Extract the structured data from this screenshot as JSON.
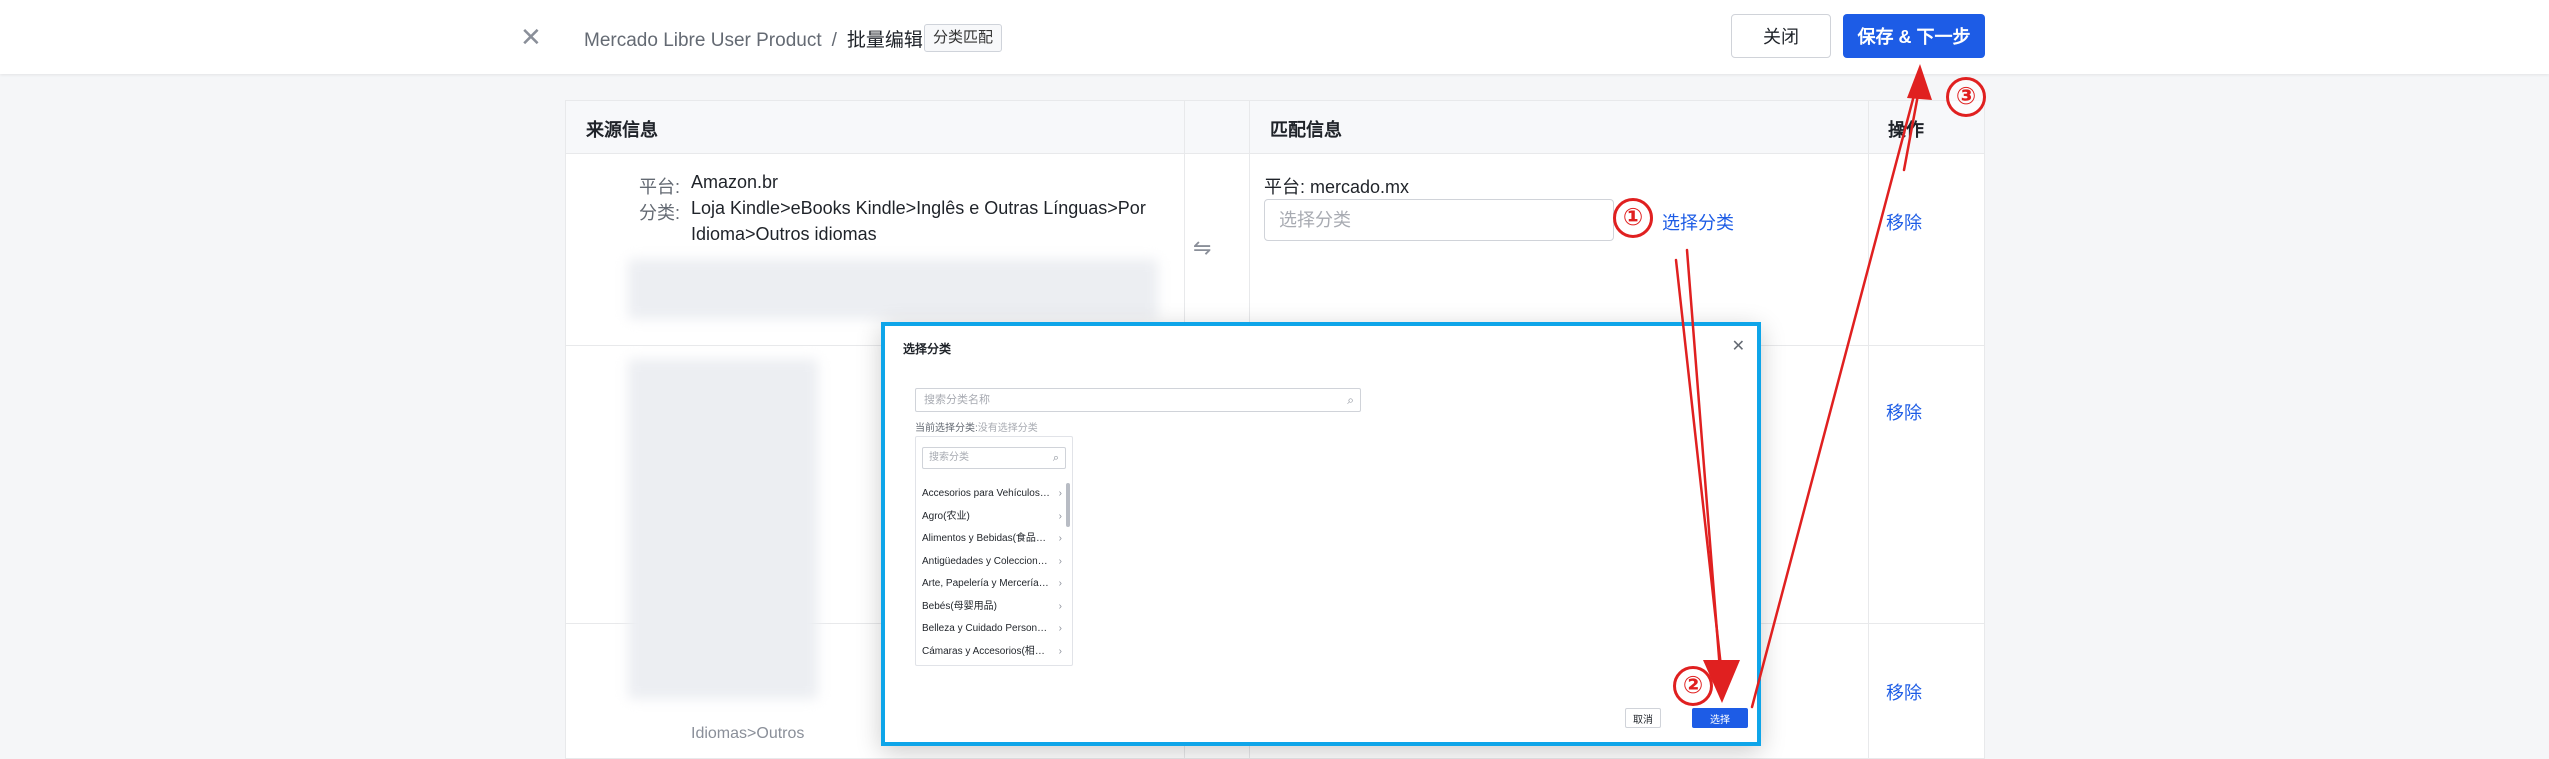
{
  "header": {
    "close_icon": "close-icon",
    "breadcrumb": {
      "app": "Mercado Libre User Product",
      "separator": "/",
      "page": "批量编辑"
    },
    "tag": "分类匹配",
    "close_button": "关闭",
    "save_button": "保存 & 下一步"
  },
  "table": {
    "columns": [
      "来源信息",
      "匹配信息",
      "操作"
    ],
    "rows": [
      {
        "source_platform_label": "平台:",
        "source_platform": "Amazon.br",
        "source_category_label": "分类:",
        "source_category_line1": "Loja Kindle>eBooks Kindle>Inglês e Outras Línguas>Por",
        "source_category_line2": "Idioma>Outros idiomas",
        "target_platform": "平台: mercado.mx",
        "target_placeholder": "选择分类",
        "select_link": "选择分类",
        "remove": "移除"
      },
      {
        "remove": "移除"
      },
      {
        "remove": "移除",
        "partial_text": "Idiomas>Outros"
      }
    ]
  },
  "modal": {
    "title": "选择分类",
    "search_placeholder": "搜索分类名称",
    "current_label": "当前选择分类:",
    "current_value": "没有选择分类",
    "panel_search_placeholder": "搜索分类",
    "categories": [
      "Accesorios para Vehículos(车辆配件)",
      "Agro(农业)",
      "Alimentos y Bebidas(食品和饮料)",
      "Antigüedades y Colecciones(古董和收藏)",
      "Arte, Papelería y Mercería(艺术、文具)",
      "Bebés(母婴用品)",
      "Belleza y Cuidado Personal(美容和个人护理)",
      "Cámaras y Accesorios(相机及配件)"
    ],
    "cancel": "取消",
    "confirm": "选择"
  },
  "annotations": {
    "step1": "①",
    "step2": "②",
    "step3": "③",
    "color": "#e02020"
  },
  "colors": {
    "primary": "#1d5ce6",
    "modal_border": "#0ea5e9"
  }
}
